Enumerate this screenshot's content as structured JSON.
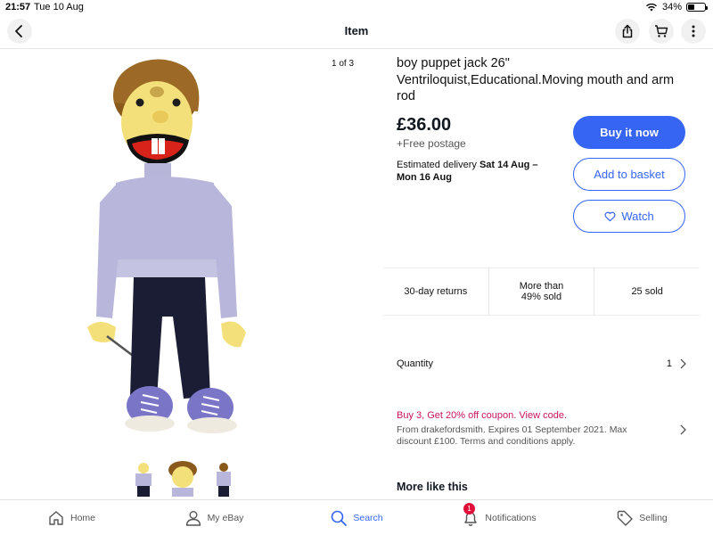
{
  "status_bar": {
    "time": "21:57",
    "date": "Tue 10 Aug",
    "battery": "34%",
    "battery_level": 0.34
  },
  "nav": {
    "title": "Item",
    "icons": [
      "back-icon",
      "share-icon",
      "cart-icon",
      "more-icon"
    ]
  },
  "gallery": {
    "counter": "1 of 3",
    "thumbnail_count": 3
  },
  "item": {
    "title": "boy puppet jack 26\" Ventriloquist,Educational.Moving mouth and arm rod",
    "price": "£36.00",
    "postage": "+Free postage",
    "delivery_label": "Estimated delivery",
    "delivery_dates": "Sat 14 Aug – Mon 16 Aug"
  },
  "actions": {
    "buy": "Buy it now",
    "basket": "Add to basket",
    "watch": "Watch"
  },
  "stats": [
    {
      "label": "30-day returns"
    },
    {
      "label": "More than 49% sold"
    },
    {
      "label": "25 sold"
    }
  ],
  "quantity": {
    "label": "Quantity",
    "value": "1"
  },
  "promo": {
    "title": "Buy 3, Get 20% off coupon. View code.",
    "description": "From drakefordsmith. Expires 01 September 2021. Max discount £100. Terms and conditions apply."
  },
  "more_like": {
    "heading": "More like this"
  },
  "tabs": [
    {
      "label": "Home",
      "icon": "home-icon"
    },
    {
      "label": "My eBay",
      "icon": "person-icon"
    },
    {
      "label": "Search",
      "icon": "search-icon",
      "active": true
    },
    {
      "label": "Notifications",
      "icon": "bell-icon",
      "badge": "1"
    },
    {
      "label": "Selling",
      "icon": "tag-icon"
    }
  ],
  "colors": {
    "accent": "#3665f3",
    "promo": "#c5145f",
    "badge": "#e0103a"
  }
}
